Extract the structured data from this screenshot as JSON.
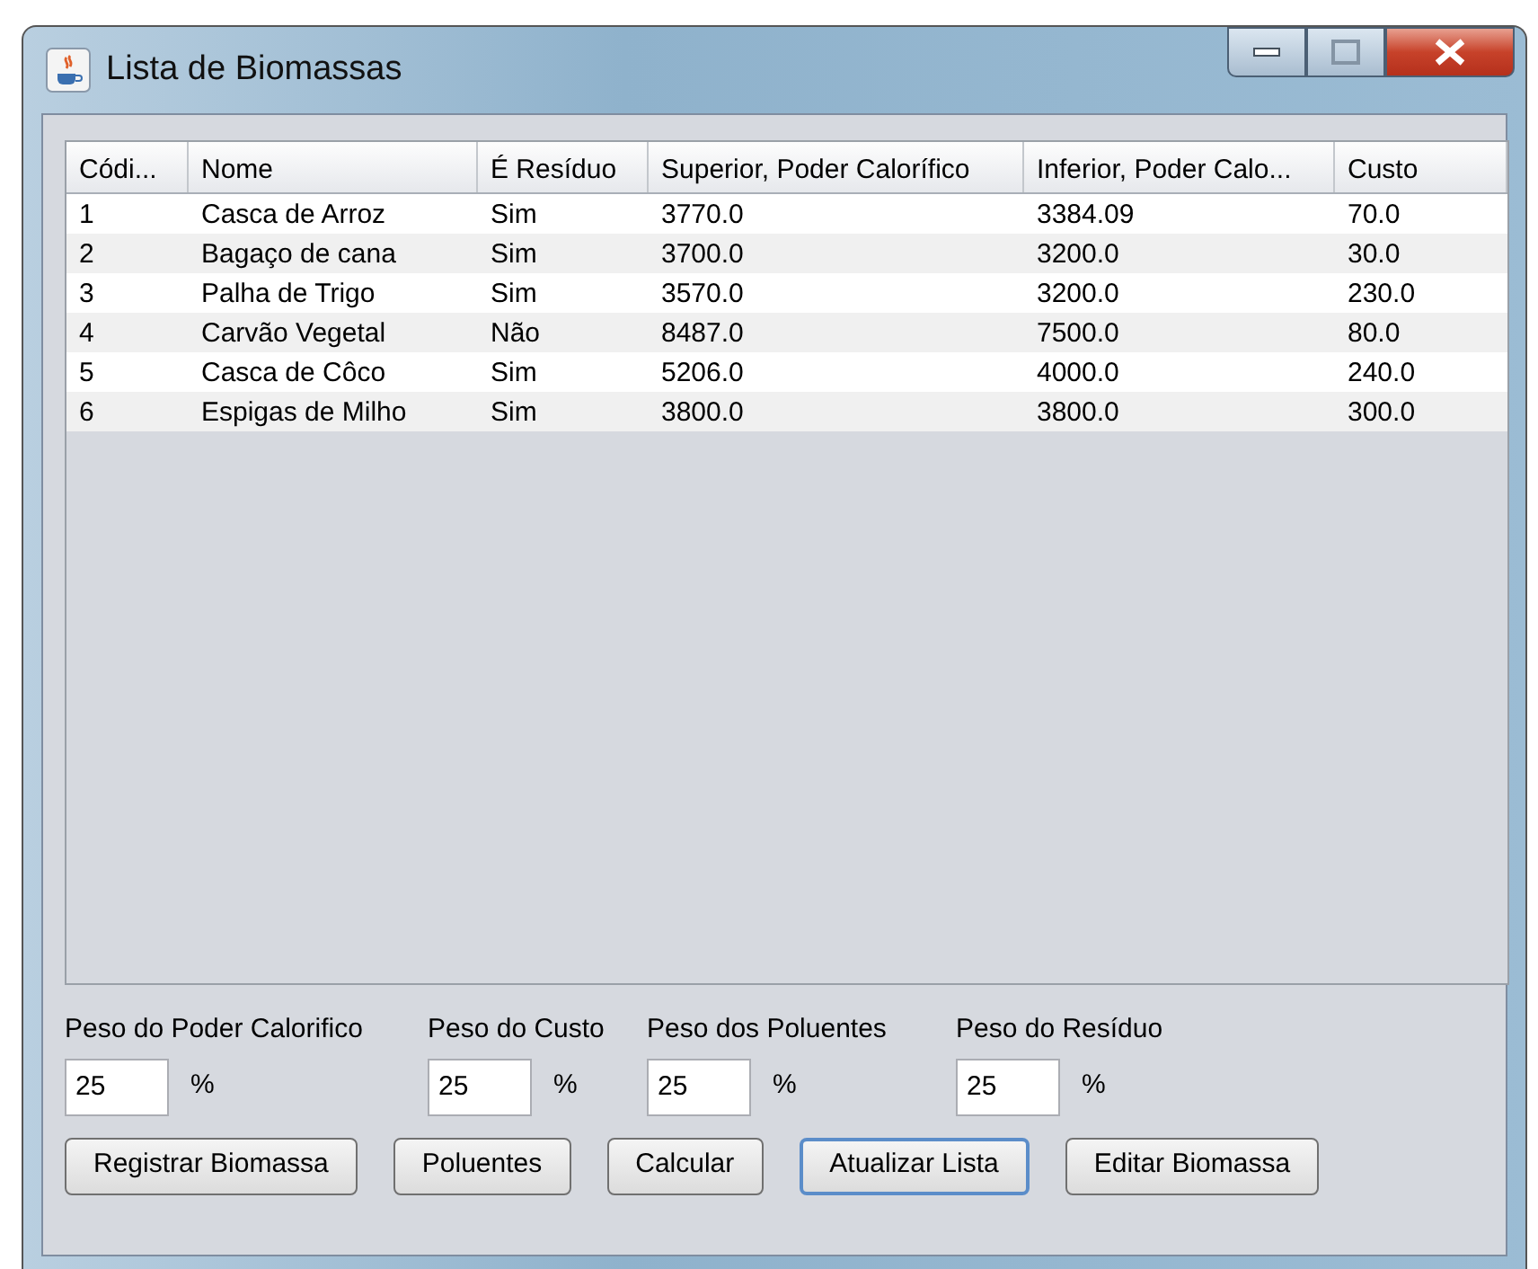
{
  "window": {
    "title": "Lista de Biomassas"
  },
  "table": {
    "columns": [
      "Códi...",
      "Nome",
      "É Resíduo",
      "Superior, Poder Calorífico",
      "Inferior, Poder Calo...",
      "Custo"
    ],
    "rows": [
      [
        "1",
        "Casca de Arroz",
        "Sim",
        "3770.0",
        "3384.09",
        "70.0"
      ],
      [
        "2",
        "Bagaço de cana",
        "Sim",
        "3700.0",
        "3200.0",
        "30.0"
      ],
      [
        "3",
        "Palha de Trigo",
        "Sim",
        "3570.0",
        "3200.0",
        "230.0"
      ],
      [
        "4",
        "Carvão Vegetal",
        "Não",
        "8487.0",
        "7500.0",
        "80.0"
      ],
      [
        "5",
        "Casca de Côco",
        "Sim",
        "5206.0",
        "4000.0",
        "240.0"
      ],
      [
        "6",
        "Espigas de Milho",
        "Sim",
        "3800.0",
        "3800.0",
        "300.0"
      ]
    ]
  },
  "weights": [
    {
      "label": "Peso do Poder Calorifico",
      "value": "25",
      "unit": "%"
    },
    {
      "label": "Peso do Custo",
      "value": "25",
      "unit": "%"
    },
    {
      "label": "Peso dos Poluentes",
      "value": "25",
      "unit": "%"
    },
    {
      "label": "Peso do Resíduo",
      "value": "25",
      "unit": "%"
    }
  ],
  "buttons": [
    {
      "label": "Registrar Biomassa",
      "focused": false
    },
    {
      "label": "Poluentes",
      "focused": false
    },
    {
      "label": "Calcular",
      "focused": false
    },
    {
      "label": "Atualizar Lista",
      "focused": true
    },
    {
      "label": "Editar Biomassa",
      "focused": false
    }
  ]
}
